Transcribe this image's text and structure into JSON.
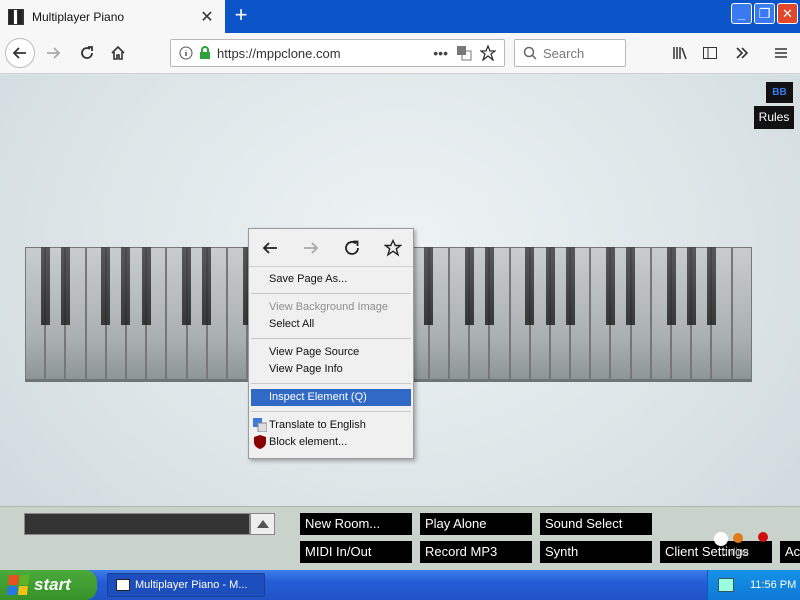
{
  "browser": {
    "tab_title": "Multiplayer Piano",
    "url": "https://mppclone.com",
    "search_placeholder": "Search",
    "new_tab": "+"
  },
  "page": {
    "badge": "BB",
    "rules_button": "Rules",
    "piano": {
      "white_keys": 36
    }
  },
  "bottom_panel": {
    "buttons": [
      "New Room...",
      "Play Alone",
      "Sound Select",
      "MIDI In/Out",
      "Record MP3",
      "Synth",
      "Client Settings",
      "Ac"
    ],
    "online_label": "online",
    "status_colors": [
      "#ffffff",
      "#e07b1a",
      "#d01010"
    ]
  },
  "context_menu": {
    "items": [
      {
        "label": "Save Page As...",
        "enabled": true
      },
      {
        "label": "View Background Image",
        "enabled": false
      },
      {
        "label": "Select All",
        "enabled": true
      },
      {
        "label": "View Page Source",
        "enabled": true
      },
      {
        "label": "View Page Info",
        "enabled": true
      },
      {
        "label": "Inspect Element (Q)",
        "enabled": true,
        "highlighted": true
      },
      {
        "label": "Translate to English",
        "enabled": true,
        "icon": "translate-icon"
      },
      {
        "label": "Block element...",
        "enabled": true,
        "icon": "ublock-icon"
      }
    ]
  },
  "taskbar": {
    "start_label": "start",
    "task_label": "Multiplayer Piano - M...",
    "clock": "11:56 PM"
  }
}
